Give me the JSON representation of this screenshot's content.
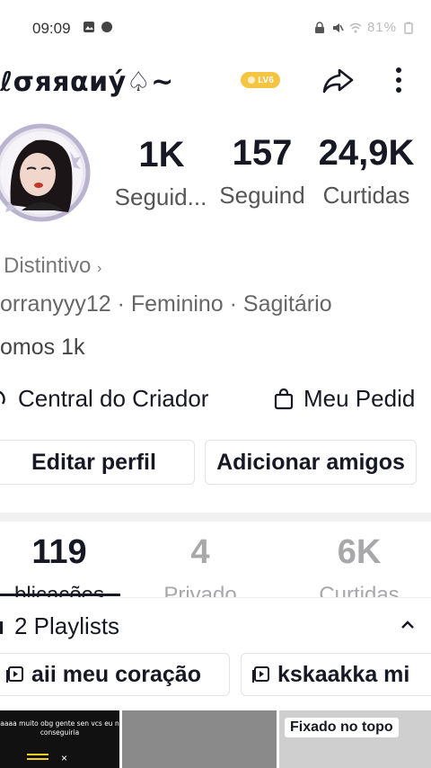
{
  "status_bar": {
    "time": "09:09",
    "battery": "81%"
  },
  "profile": {
    "username": "ℓσяяαиý♤~",
    "level_badge": "LV6",
    "stats": [
      {
        "value": "1K",
        "label": "Seguid..."
      },
      {
        "value": "157",
        "label": "Seguind"
      },
      {
        "value": "24,9K",
        "label": "Curtidas"
      }
    ],
    "badge_link": "Distintivo",
    "bio_info": "orranyyy12 · Feminino · Sagitário",
    "bio_text": "omos 1k"
  },
  "quick_links": {
    "creator_center": "Central do Criador",
    "orders": "Meu Pedid"
  },
  "buttons": {
    "edit_profile": "Editar perfil",
    "add_friends": "Adicionar amigos"
  },
  "tabs": [
    {
      "value": "119",
      "label": "blicações"
    },
    {
      "value": "4",
      "label": "Privado"
    },
    {
      "value": "6K",
      "label": "Curtidas"
    }
  ],
  "playlists": {
    "header": "2 Playlists",
    "items": [
      "aii meu coração",
      "kskaakka mi"
    ]
  },
  "thumbnails": {
    "caption_1": "aaaa muito obg gente sen vcs eu n conseguiria",
    "pinned_label": "Fixado no topo"
  },
  "colors": {
    "text": "#161823",
    "muted": "#777777",
    "border": "#e3e3e4",
    "badge": "#f5c542"
  }
}
